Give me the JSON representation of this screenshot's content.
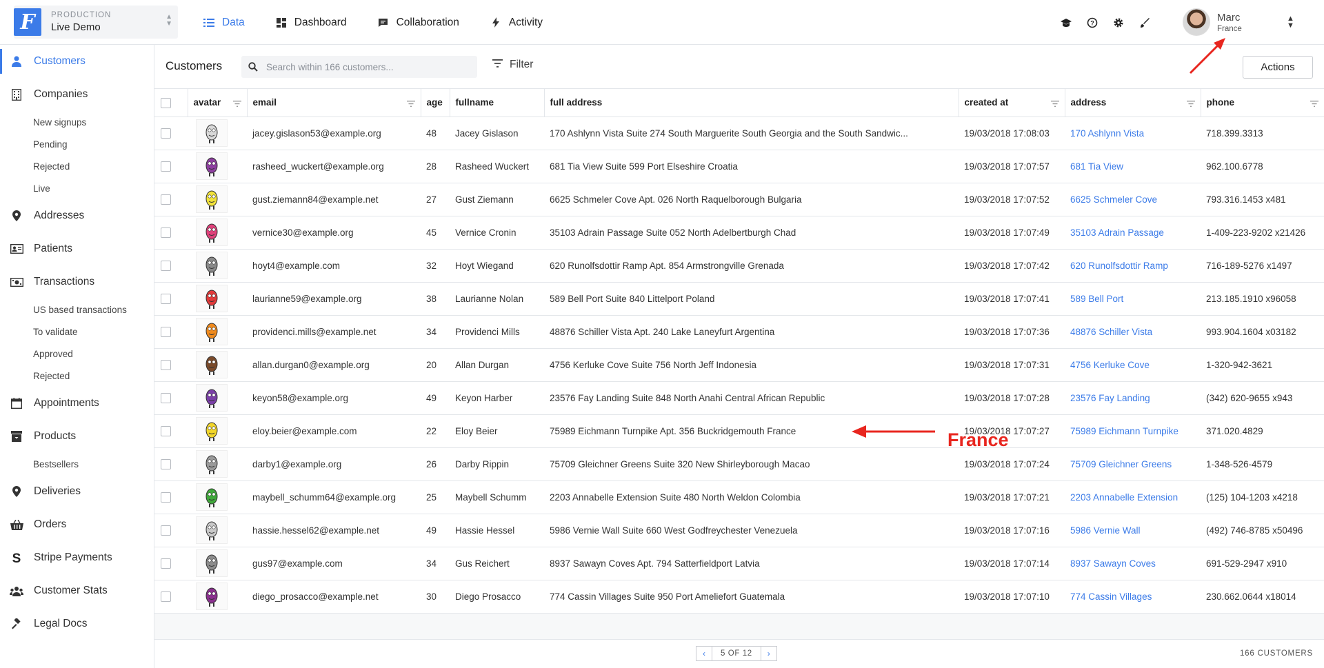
{
  "env": {
    "label": "PRODUCTION",
    "name": "Live Demo",
    "logo_letter": "F"
  },
  "nav": [
    {
      "label": "Data",
      "icon": "list-icon",
      "active": true
    },
    {
      "label": "Dashboard",
      "icon": "dashboard-icon",
      "active": false
    },
    {
      "label": "Collaboration",
      "icon": "chat-icon",
      "active": false
    },
    {
      "label": "Activity",
      "icon": "bolt-icon",
      "active": false
    }
  ],
  "top_icons": [
    "graduation-cap-icon",
    "help-icon",
    "gear-icon",
    "brush-icon"
  ],
  "user": {
    "name": "Marc",
    "country": "France"
  },
  "sidebar": {
    "customers": "Customers",
    "companies": "Companies",
    "companies_sub": [
      "New signups",
      "Pending",
      "Rejected",
      "Live"
    ],
    "addresses": "Addresses",
    "patients": "Patients",
    "transactions": "Transactions",
    "transactions_sub": [
      "US based transactions",
      "To validate",
      "Approved",
      "Rejected"
    ],
    "appointments": "Appointments",
    "products": "Products",
    "products_sub": [
      "Bestsellers"
    ],
    "deliveries": "Deliveries",
    "orders": "Orders",
    "stripe": "Stripe Payments",
    "stats": "Customer Stats",
    "legal": "Legal Docs"
  },
  "toolbar": {
    "title": "Customers",
    "search_placeholder": "Search within 166 customers...",
    "filter_label": "Filter",
    "actions_label": "Actions"
  },
  "columns": [
    "avatar",
    "email",
    "age",
    "fullname",
    "full address",
    "created at",
    "address",
    "phone"
  ],
  "rows": [
    {
      "color": "#d9d9d9",
      "email": "jacey.gislason53@example.org",
      "age": "48",
      "fullname": "Jacey Gislason",
      "full_address": "170 Ashlynn Vista Suite 274 South Marguerite South Georgia and the South Sandwic...",
      "created_at": "19/03/2018 17:08:03",
      "address": "170 Ashlynn Vista",
      "phone": "718.399.3313"
    },
    {
      "color": "#8e3fa0",
      "email": "rasheed_wuckert@example.org",
      "age": "28",
      "fullname": "Rasheed Wuckert",
      "full_address": "681 Tia View Suite 599 Port Elseshire Croatia",
      "created_at": "19/03/2018 17:07:57",
      "address": "681 Tia View",
      "phone": "962.100.6778"
    },
    {
      "color": "#f2e33a",
      "email": "gust.ziemann84@example.net",
      "age": "27",
      "fullname": "Gust Ziemann",
      "full_address": "6625 Schmeler Cove Apt. 026 North Raquelborough Bulgaria",
      "created_at": "19/03/2018 17:07:52",
      "address": "6625 Schmeler Cove",
      "phone": "793.316.1453 x481"
    },
    {
      "color": "#e0407a",
      "email": "vernice30@example.org",
      "age": "45",
      "fullname": "Vernice Cronin",
      "full_address": "35103 Adrain Passage Suite 052 North Adelbertburgh Chad",
      "created_at": "19/03/2018 17:07:49",
      "address": "35103 Adrain Passage",
      "phone": "1-409-223-9202 x21426"
    },
    {
      "color": "#8a8a8a",
      "email": "hoyt4@example.com",
      "age": "32",
      "fullname": "Hoyt Wiegand",
      "full_address": "620 Runolfsdottir Ramp Apt. 854 Armstrongville Grenada",
      "created_at": "19/03/2018 17:07:42",
      "address": "620 Runolfsdottir Ramp",
      "phone": "716-189-5276 x1497"
    },
    {
      "color": "#e23a3a",
      "email": "laurianne59@example.org",
      "age": "38",
      "fullname": "Laurianne Nolan",
      "full_address": "589 Bell Port Suite 840 Littelport Poland",
      "created_at": "19/03/2018 17:07:41",
      "address": "589 Bell Port",
      "phone": "213.185.1910 x96058"
    },
    {
      "color": "#f08a1c",
      "email": "providenci.mills@example.net",
      "age": "34",
      "fullname": "Providenci Mills",
      "full_address": "48876 Schiller Vista Apt. 240 Lake Laneyfurt Argentina",
      "created_at": "19/03/2018 17:07:36",
      "address": "48876 Schiller Vista",
      "phone": "993.904.1604 x03182"
    },
    {
      "color": "#7a4a2a",
      "email": "allan.durgan0@example.org",
      "age": "20",
      "fullname": "Allan Durgan",
      "full_address": "4756 Kerluke Cove Suite 756 North Jeff Indonesia",
      "created_at": "19/03/2018 17:07:31",
      "address": "4756 Kerluke Cove",
      "phone": "1-320-942-3621"
    },
    {
      "color": "#7b3fa8",
      "email": "keyon58@example.org",
      "age": "49",
      "fullname": "Keyon Harber",
      "full_address": "23576 Fay Landing Suite 848 North Anahi Central African Republic",
      "created_at": "19/03/2018 17:07:28",
      "address": "23576 Fay Landing",
      "phone": "(342) 620-9655 x943"
    },
    {
      "color": "#f2d62a",
      "email": "eloy.beier@example.com",
      "age": "22",
      "fullname": "Eloy Beier",
      "full_address": "75989 Eichmann Turnpike Apt. 356 Buckridgemouth France",
      "created_at": "19/03/2018 17:07:27",
      "address": "75989 Eichmann Turnpike",
      "phone": "371.020.4829"
    },
    {
      "color": "#9a9a9a",
      "email": "darby1@example.org",
      "age": "26",
      "fullname": "Darby Rippin",
      "full_address": "75709 Gleichner Greens Suite 320 New Shirleyborough Macao",
      "created_at": "19/03/2018 17:07:24",
      "address": "75709 Gleichner Greens",
      "phone": "1-348-526-4579"
    },
    {
      "color": "#3fa83a",
      "email": "maybell_schumm64@example.org",
      "age": "25",
      "fullname": "Maybell Schumm",
      "full_address": "2203 Annabelle Extension Suite 480 North Weldon Colombia",
      "created_at": "19/03/2018 17:07:21",
      "address": "2203 Annabelle Extension",
      "phone": "(125) 104-1203 x4218"
    },
    {
      "color": "#c9c9c9",
      "email": "hassie.hessel62@example.net",
      "age": "49",
      "fullname": "Hassie Hessel",
      "full_address": "5986 Vernie Wall Suite 660 West Godfreychester Venezuela",
      "created_at": "19/03/2018 17:07:16",
      "address": "5986 Vernie Wall",
      "phone": "(492) 746-8785 x50496"
    },
    {
      "color": "#8c8c8c",
      "email": "gus97@example.com",
      "age": "34",
      "fullname": "Gus Reichert",
      "full_address": "8937 Sawayn Coves Apt. 794 Satterfieldport Latvia",
      "created_at": "19/03/2018 17:07:14",
      "address": "8937 Sawayn Coves",
      "phone": "691-529-2947 x910"
    },
    {
      "color": "#8b2f8f",
      "email": "diego_prosacco@example.net",
      "age": "30",
      "fullname": "Diego Prosacco",
      "full_address": "774 Cassin Villages Suite 950 Port Ameliefort Guatemala",
      "created_at": "19/03/2018 17:07:10",
      "address": "774 Cassin Villages",
      "phone": "230.662.0644 x18014"
    }
  ],
  "pagination": {
    "label": "5 OF 12",
    "prev": "‹",
    "next": "›"
  },
  "count_label": "166 CUSTOMERS",
  "annotation": {
    "label": "France",
    "color": "#e8261f"
  },
  "colors": {
    "accent": "#3b7be8",
    "annotation": "#e8261f"
  }
}
